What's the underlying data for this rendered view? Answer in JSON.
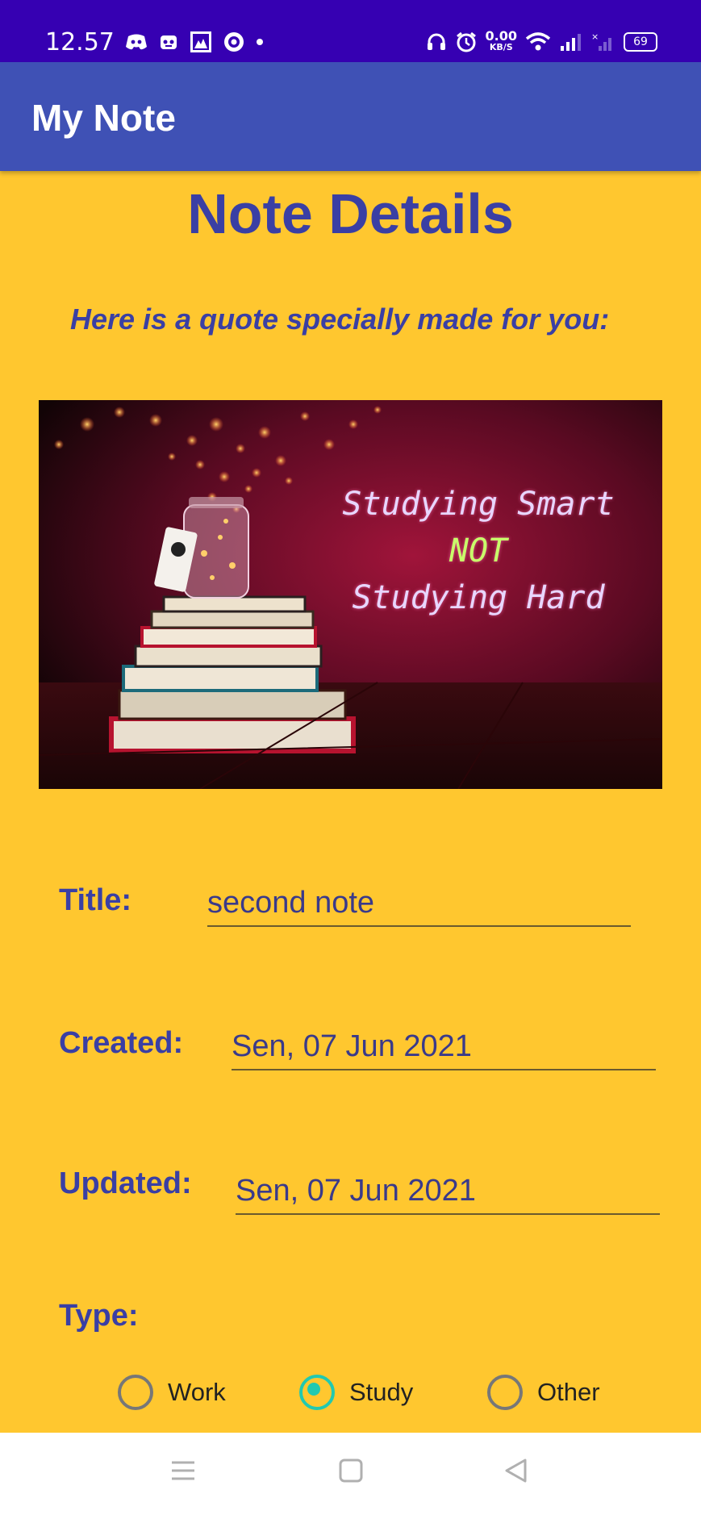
{
  "status_bar": {
    "time": "12.57",
    "net_speed_value": "0.00",
    "net_speed_unit": "KB/S",
    "battery": "69",
    "left_icons": [
      "discord-icon",
      "game-icon",
      "photo-icon",
      "pocket-casts-icon",
      "dot-icon"
    ],
    "right_icons": [
      "headset-icon",
      "alarm-icon",
      "wifi-icon",
      "signal-icon",
      "signal-x-icon"
    ]
  },
  "app_bar": {
    "title": "My Note"
  },
  "page": {
    "heading": "Note Details",
    "quote_intro": "Here is a quote specially made for you:",
    "quote_image": {
      "line1": "Studying Smart",
      "line2": "NOT",
      "line3": "Studying Hard"
    }
  },
  "fields": {
    "title_label": "Title:",
    "title_value": "second note",
    "created_label": "Created:",
    "created_value": "Sen, 07 Jun 2021",
    "updated_label": "Updated:",
    "updated_value": "Sen, 07 Jun 2021",
    "type_label": "Type:"
  },
  "type_options": [
    {
      "label": "Work",
      "checked": false
    },
    {
      "label": "Study",
      "checked": true
    },
    {
      "label": "Other",
      "checked": false
    }
  ],
  "colors": {
    "status_bar": "#3600b2",
    "app_bar": "#3f51b5",
    "background": "#ffc72f",
    "accent_text": "#3a3fa4",
    "radio_checked": "#22c9b0"
  },
  "nav_bar": {
    "icons": [
      "menu-icon",
      "home-icon",
      "back-icon"
    ]
  }
}
